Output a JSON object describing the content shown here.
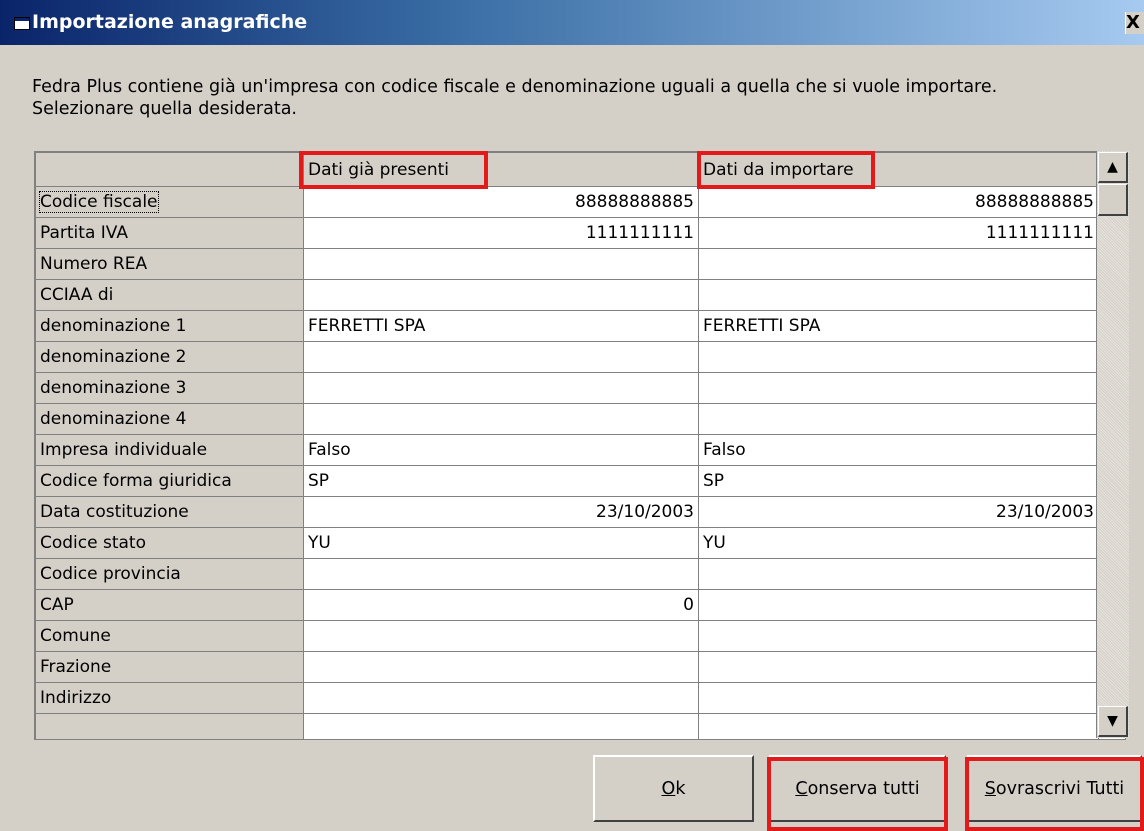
{
  "window": {
    "title": "Importazione anagrafiche",
    "close_label": "X"
  },
  "message": {
    "line1": "Fedra Plus contiene già un'impresa con codice fiscale e denominazione uguali a quella che si vuole importare.",
    "line2": "Selezionare quella desiderata."
  },
  "grid": {
    "columns": [
      "Dati già presenti",
      "Dati da importare"
    ],
    "rows": [
      {
        "label": "Codice fiscale",
        "existing": "88888888885",
        "imported": "88888888885"
      },
      {
        "label": "Partita IVA",
        "existing": "1111111111",
        "imported": "1111111111"
      },
      {
        "label": "Numero REA",
        "existing": "",
        "imported": ""
      },
      {
        "label": "CCIAA di",
        "existing": "",
        "imported": ""
      },
      {
        "label": "denominazione 1",
        "existing": "FERRETTI SPA",
        "imported": "FERRETTI SPA"
      },
      {
        "label": "denominazione 2",
        "existing": "",
        "imported": ""
      },
      {
        "label": "denominazione 3",
        "existing": "",
        "imported": ""
      },
      {
        "label": "denominazione 4",
        "existing": "",
        "imported": ""
      },
      {
        "label": "Impresa individuale",
        "existing": "Falso",
        "imported": "Falso"
      },
      {
        "label": "Codice forma giuridica",
        "existing": "SP",
        "imported": "SP"
      },
      {
        "label": "Data costituzione",
        "existing": "23/10/2003",
        "imported": "23/10/2003"
      },
      {
        "label": "Codice stato",
        "existing": "YU",
        "imported": "YU"
      },
      {
        "label": "Codice provincia",
        "existing": "",
        "imported": ""
      },
      {
        "label": "CAP",
        "existing": "0",
        "imported": ""
      },
      {
        "label": "Comune",
        "existing": "",
        "imported": ""
      },
      {
        "label": "Frazione",
        "existing": "",
        "imported": ""
      },
      {
        "label": "Indirizzo",
        "existing": "",
        "imported": ""
      },
      {
        "label": "",
        "existing": "",
        "imported": ""
      }
    ]
  },
  "buttons": {
    "ok": {
      "accel": "O",
      "rest": "k"
    },
    "keep": {
      "accel": "C",
      "rest": "onserva tutti"
    },
    "overwrite": {
      "accel": "S",
      "rest": "ovrascrivi Tutti"
    }
  },
  "colors": {
    "highlight": "#e21a1a",
    "dialog_bg": "#d4d0c8",
    "titlebar": "#0a246a"
  }
}
